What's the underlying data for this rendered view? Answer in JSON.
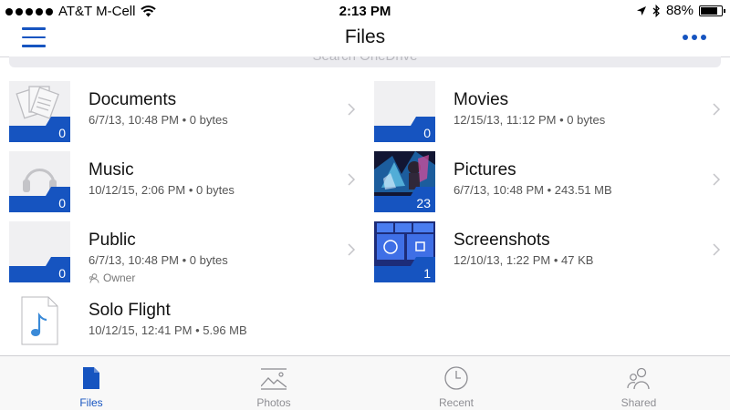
{
  "status_bar": {
    "carrier": "AT&T M-Cell",
    "time": "2:13 PM",
    "battery_percent": "88%",
    "battery_level": 0.88
  },
  "nav": {
    "title": "Files",
    "menu_icon": "hamburger-icon",
    "more_icon": "ellipsis-icon"
  },
  "search": {
    "placeholder": "Search OneDrive"
  },
  "items": [
    {
      "name": "Documents",
      "meta": "6/7/13, 10:48 PM • 0 bytes",
      "count": "0",
      "kind": "folder",
      "thumb": "documents"
    },
    {
      "name": "Movies",
      "meta": "12/15/13, 11:12 PM • 0 bytes",
      "count": "0",
      "kind": "folder",
      "thumb": "blank"
    },
    {
      "name": "Music",
      "meta": "10/12/15, 2:06 PM • 0 bytes",
      "count": "0",
      "kind": "folder",
      "thumb": "headphones"
    },
    {
      "name": "Pictures",
      "meta": "6/7/13, 10:48 PM • 243.51 MB",
      "count": "23",
      "kind": "folder",
      "thumb": "photo"
    },
    {
      "name": "Public",
      "meta": "6/7/13, 10:48 PM • 0 bytes",
      "count": "0",
      "kind": "folder",
      "thumb": "blank",
      "owner": "Owner"
    },
    {
      "name": "Screenshots",
      "meta": "12/10/13, 1:22 PM • 47 KB",
      "count": "1",
      "kind": "folder",
      "thumb": "tiles"
    },
    {
      "name": "Solo Flight",
      "meta": "10/12/15, 12:41 PM • 5.96 MB",
      "kind": "audio-file"
    }
  ],
  "tabs": [
    {
      "label": "Files",
      "icon": "file-icon",
      "active": true
    },
    {
      "label": "Photos",
      "icon": "photos-icon",
      "active": false
    },
    {
      "label": "Recent",
      "icon": "clock-icon",
      "active": false
    },
    {
      "label": "Shared",
      "icon": "people-icon",
      "active": false
    }
  ],
  "colors": {
    "accent": "#1654c0",
    "folder_bg": "#f0f0f2",
    "text_secondary": "#555555"
  }
}
